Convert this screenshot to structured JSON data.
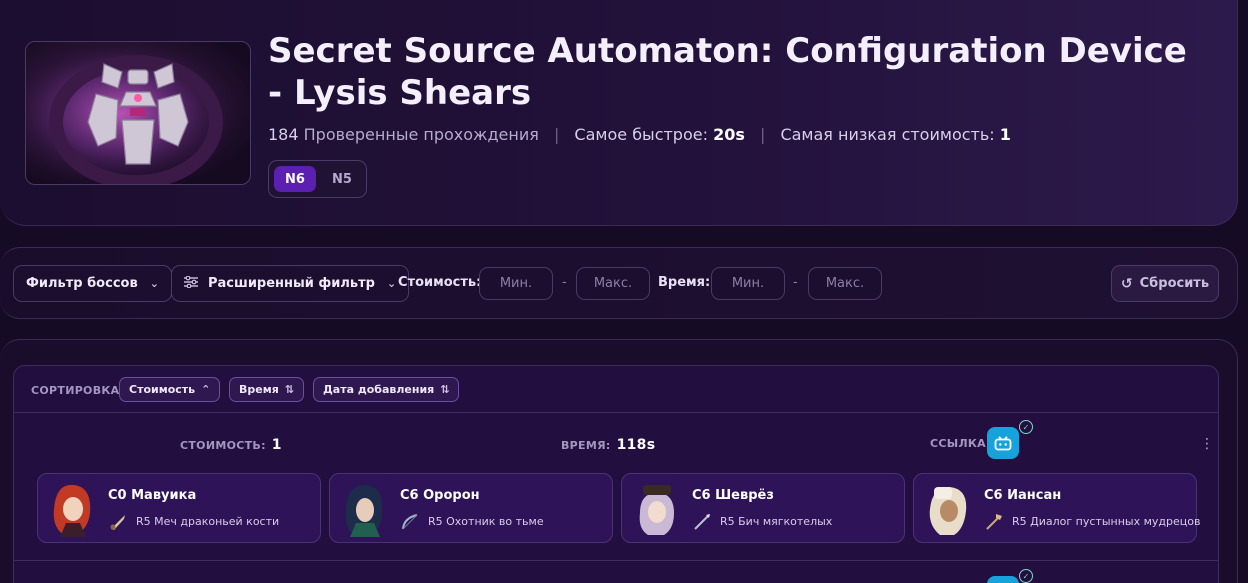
{
  "hero": {
    "title": "Secret Source Automaton: Configuration Device - Lysis Shears",
    "verified_count": "184",
    "verified_label": "Проверенные прохождения",
    "fastest_label": "Самое быстрое:",
    "fastest_value": "20s",
    "lowest_cost_label": "Самая низкая стоимость:",
    "lowest_cost_value": "1",
    "separator": "|",
    "difficulty": {
      "active": "N6",
      "other": "N5"
    }
  },
  "filters": {
    "boss_filter": "Фильтр боссов",
    "advanced_filter": "Расширенный фильтр",
    "cost_label": "Стоимость:",
    "time_label": "Время:",
    "min_placeholder": "Мин.",
    "max_placeholder": "Макс.",
    "dash": "-",
    "reset": "Сбросить"
  },
  "sort": {
    "label": "СОРТИРОВКА",
    "options": [
      {
        "label": "Стоимость",
        "icon": "chevron-up-icon"
      },
      {
        "label": "Время",
        "icon": "sort-arrows-icon"
      },
      {
        "label": "Дата добавления",
        "icon": "sort-arrows-icon"
      }
    ]
  },
  "runs": [
    {
      "cost_label": "СТОИМОСТЬ:",
      "cost": "1",
      "time_label": "ВРЕМЯ:",
      "time": "118s",
      "link_label": "ССЫЛКА:",
      "characters": [
        {
          "name": "C0 Мавуика",
          "weapon": "R5 Меч драконьей кости"
        },
        {
          "name": "C6 Оророн",
          "weapon": "R5 Охотник во тьме"
        },
        {
          "name": "C6 Шеврёз",
          "weapon": "R5 Бич мягкотелых"
        },
        {
          "name": "C6 Иансан",
          "weapon": "R5 Диалог пустынных мудрецов"
        }
      ]
    }
  ],
  "colors": {
    "accent": "#5b1fb2",
    "bilibili": "#16a3dc",
    "card_bg": "#2f1358"
  }
}
